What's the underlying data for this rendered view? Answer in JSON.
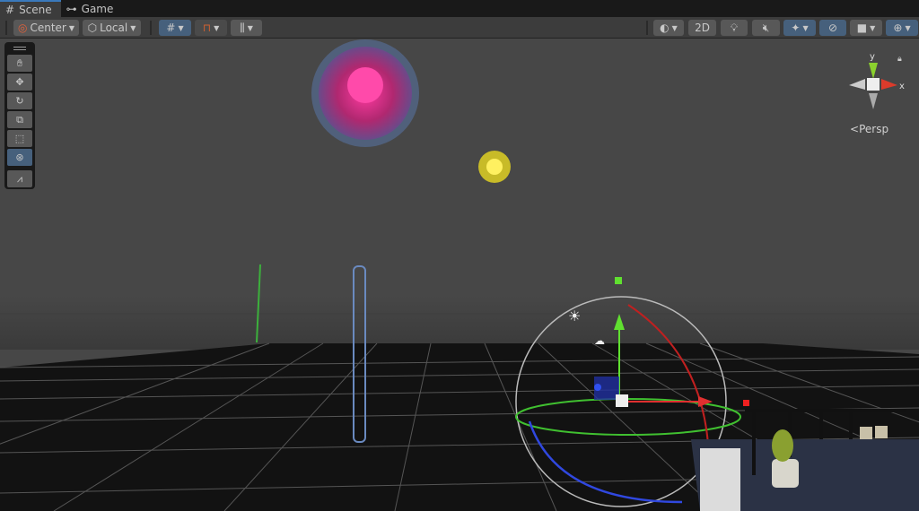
{
  "tabs": [
    {
      "label": "Scene",
      "icon": "grid-icon",
      "active": true
    },
    {
      "label": "Game",
      "icon": "gamepad-icon",
      "active": false
    }
  ],
  "toolbar": {
    "pivot_label": "Center",
    "space_label": "Local",
    "view_2d_label": "2D"
  },
  "tools": [
    {
      "name": "hand-tool",
      "icon": "hand-icon"
    },
    {
      "name": "move-tool",
      "icon": "move-icon"
    },
    {
      "name": "rotate-tool",
      "icon": "rotate-icon"
    },
    {
      "name": "scale-tool",
      "icon": "scale-icon"
    },
    {
      "name": "rect-tool",
      "icon": "rect-icon"
    },
    {
      "name": "transform-tool",
      "icon": "transform-icon",
      "active": true
    },
    {
      "name": "custom-tool",
      "icon": "custom-tool-icon"
    }
  ],
  "gizmo": {
    "y_label": "y",
    "x_label": "x",
    "projection_label": "Persp"
  },
  "colors": {
    "accent": "#46607c",
    "x_axis": "#db3b2b",
    "y_axis": "#8bd12e",
    "z_axis": "#3a5cd8",
    "firework_pink": "#e6338f",
    "firework_yellow": "#f0e020"
  }
}
